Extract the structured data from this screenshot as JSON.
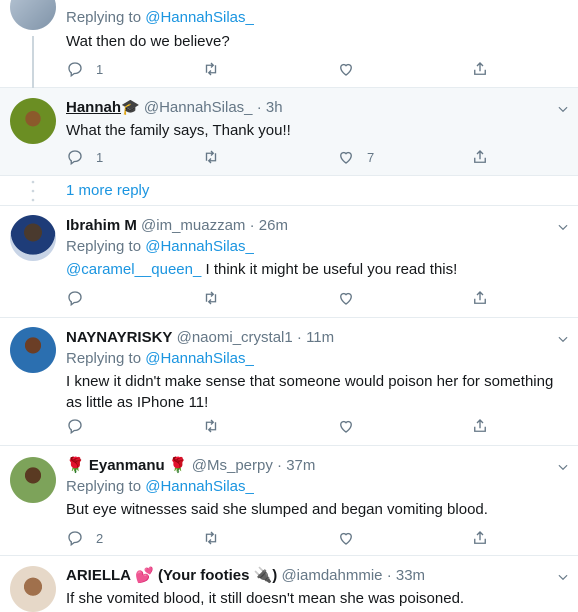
{
  "tweets": [
    {
      "replying_prefix": "Replying to ",
      "replying_to": "@HannahSilas_",
      "text": "Wat then do we believe?",
      "reply_count": "1",
      "retweet_count": "",
      "like_count": ""
    },
    {
      "name": "Hannah",
      "name_emoji": "🎓",
      "handle": "@HannahSilas_",
      "dot": "·",
      "time": "3h",
      "text": "What the family says, Thank you!!",
      "reply_count": "1",
      "retweet_count": "",
      "like_count": "7"
    },
    {
      "more_reply": "1 more reply"
    },
    {
      "name": "Ibrahim M",
      "handle": "@im_muazzam",
      "dot": "·",
      "time": "26m",
      "replying_prefix": "Replying to ",
      "replying_to": "@HannahSilas_",
      "mention": "@caramel__queen_",
      "text": " I think it might be useful you read this!",
      "reply_count": "",
      "retweet_count": "",
      "like_count": ""
    },
    {
      "name": "NAYNAYRISKY",
      "handle": "@naomi_crystal1",
      "dot": "·",
      "time": "11m",
      "replying_prefix": "Replying to ",
      "replying_to": "@HannahSilas_",
      "text_line1": "I knew it didn't make sense that someone would poison her for something",
      "text_line2": "as little as IPhone 11!",
      "reply_count": "",
      "retweet_count": "",
      "like_count": ""
    },
    {
      "name_prefix_emoji": "🌹",
      "name": "Eyanmanu",
      "name_suffix_emoji": "🌹",
      "handle": "@Ms_perpy",
      "dot": "·",
      "time": "37m",
      "replying_prefix": "Replying to ",
      "replying_to": "@HannahSilas_",
      "text": "But eye witnesses said she slumped and began vomiting blood.",
      "reply_count": "2",
      "retweet_count": "",
      "like_count": ""
    },
    {
      "name": "ARIELLA",
      "name_emoji": "💕",
      "name_suffix": "(Your footies",
      "name_suffix_emoji": "🔌)",
      "handle": "@iamdahmmie",
      "dot": "·",
      "time": "33m",
      "text": "If she vomited blood, it still doesn't mean she was poisoned."
    }
  ],
  "colors": {
    "link": "#1b95e0",
    "muted": "#657786",
    "border": "#e6ecf0",
    "highlight": "#f5f8fa"
  },
  "icons": [
    "reply-icon",
    "retweet-icon",
    "like-icon",
    "share-icon",
    "caret-down-icon"
  ]
}
